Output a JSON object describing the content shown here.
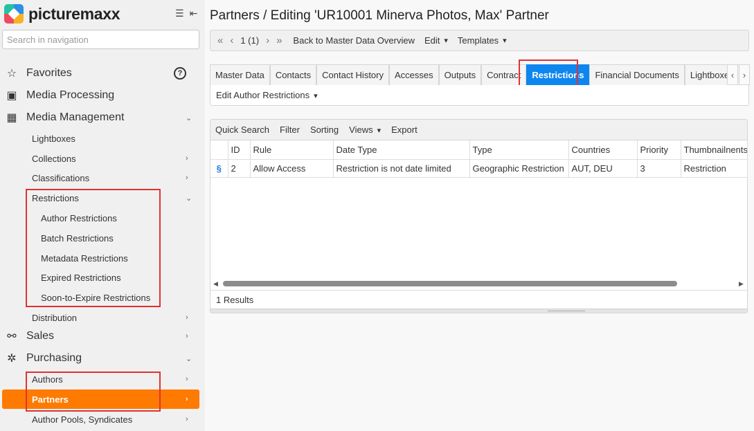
{
  "sidebar": {
    "brand": "picturemaxx",
    "search_placeholder": "Search in navigation",
    "items": [
      {
        "label": "Favorites",
        "icon": "star-icon"
      },
      {
        "label": "Media Processing",
        "icon": "image-icon"
      },
      {
        "label": "Media Management",
        "icon": "media-management-icon"
      },
      {
        "label": "Lightboxes"
      },
      {
        "label": "Collections"
      },
      {
        "label": "Classifications"
      },
      {
        "label": "Restrictions"
      },
      {
        "label": "Author Restrictions"
      },
      {
        "label": "Batch Restrictions"
      },
      {
        "label": "Metadata Restrictions"
      },
      {
        "label": "Expired Restrictions"
      },
      {
        "label": "Soon-to-Expire Restrictions"
      },
      {
        "label": "Distribution"
      },
      {
        "label": "Sales",
        "icon": "sales-icon"
      },
      {
        "label": "Purchasing",
        "icon": "purchasing-icon"
      },
      {
        "label": "Authors"
      },
      {
        "label": "Partners"
      },
      {
        "label": "Author Pools, Syndicates"
      }
    ]
  },
  "main": {
    "title": "Partners / Editing 'UR10001 Minerva Photos, Max' Partner",
    "toolbar": {
      "pager": "1 (1)",
      "back": "Back to Master Data Overview",
      "edit": "Edit",
      "templates": "Templates"
    },
    "tabs": [
      "Master Data",
      "Contacts",
      "Contact History",
      "Accesses",
      "Outputs",
      "Contract",
      "Restrictions",
      "Financial Documents",
      "Lightboxes"
    ],
    "sub_action": "Edit Author Restrictions",
    "grid_toolbar": [
      "Quick Search",
      "Filter",
      "Sorting",
      "Views",
      "Export"
    ],
    "columns": [
      "",
      "ID",
      "Rule",
      "Date Type",
      "Type",
      "Countries",
      "Priority",
      "Thumbnailnents"
    ],
    "rows": [
      {
        "icon": "§",
        "id": "2",
        "rule": "Allow Access",
        "date_type": "Restriction is not date limited",
        "type": "Geographic Restriction",
        "countries": "AUT, DEU",
        "priority": "3",
        "thumb": "Restriction"
      }
    ],
    "results": "1 Results"
  }
}
